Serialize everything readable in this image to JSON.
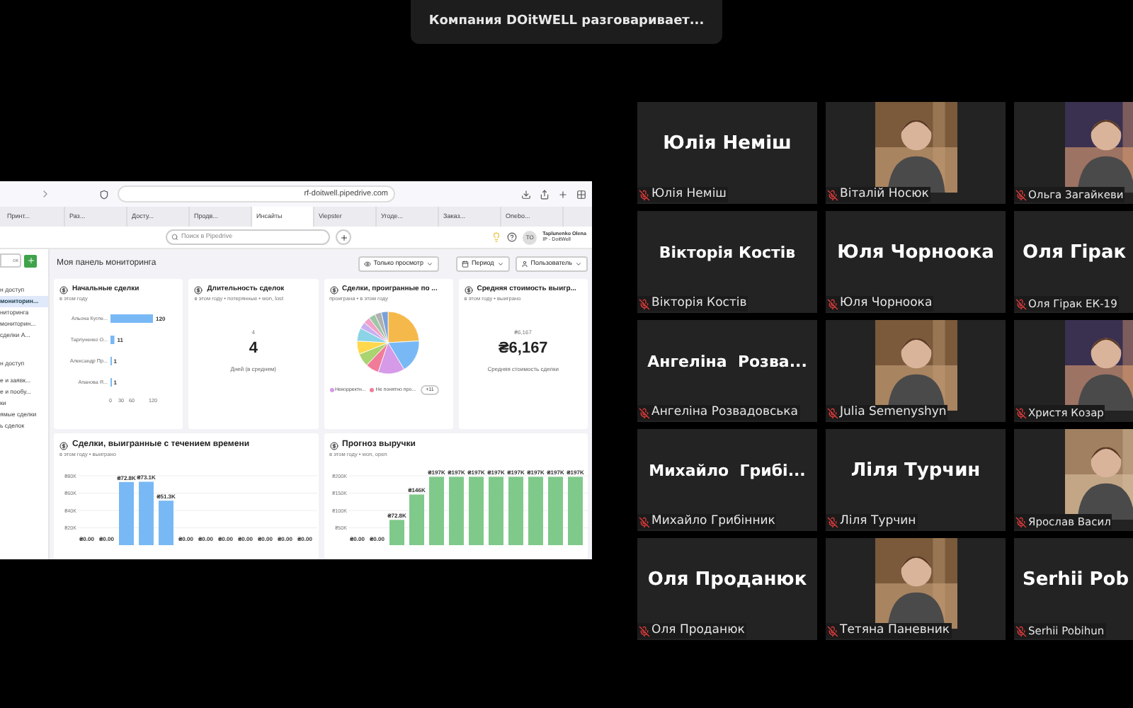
{
  "meeting_banner": {
    "title": "Компания DOitWELL разговаривает..."
  },
  "shared_screen": {
    "browser": {
      "url": "rf-doitwell.pipedrive.com",
      "tabs": [
        {
          "label": "Принт...",
          "selected": false
        },
        {
          "label": "Раз...",
          "selected": false
        },
        {
          "label": "Досту...",
          "selected": false
        },
        {
          "label": "Продв...",
          "selected": false
        },
        {
          "label": "Инсайты",
          "selected": true
        },
        {
          "label": "Viepster",
          "selected": false
        },
        {
          "label": "Угоде...",
          "selected": false
        },
        {
          "label": "Заказ...",
          "selected": false
        },
        {
          "label": "Onebo...",
          "selected": false
        }
      ]
    },
    "header": {
      "search_placeholder": "Поиск в Pipedrive",
      "avatar_initials": "TO",
      "user_name": "Taplunenko Olena",
      "user_company": "IP - DoitWell"
    },
    "sidebar": {
      "search_placeholder": "ок",
      "items": [
        {
          "label": "н доступ",
          "selected": false
        },
        {
          "label": "мониторин...",
          "selected": true
        },
        {
          "label": "ниторинга",
          "selected": false
        },
        {
          "label": "мониторин...",
          "selected": false
        },
        {
          "label": "сделки А...",
          "selected": false
        },
        {
          "label": "н доступ",
          "selected": false
        },
        {
          "label": "е и заявк...",
          "selected": false
        },
        {
          "label": "е и пообу...",
          "selected": false
        },
        {
          "label": "ки",
          "selected": false
        },
        {
          "label": "ямые сделки",
          "selected": false
        },
        {
          "label": "ь сделок",
          "selected": false
        }
      ]
    },
    "dashboard": {
      "title": "Моя панель мониторинга",
      "buttons": [
        "Только просмотр",
        "Период",
        "Пользователь"
      ],
      "cards": [
        {
          "kind": "hbar",
          "title": "Начальные сделки",
          "subtitle": "в этом году",
          "chart_data": {
            "type": "bar",
            "orientation": "horizontal",
            "categories": [
              "Альона Кугле...",
              "Тарлуненко О...",
              "Александр Пр...",
              "Апанова Я..."
            ],
            "values": [
              120,
              11,
              1,
              1
            ],
            "data_labels": true,
            "xlim": [
              0,
              120
            ],
            "xticks": [
              0,
              30,
              60,
              120
            ]
          }
        },
        {
          "kind": "number",
          "title": "Длительность сделок",
          "subtitle": "в этом году • потерянные • won, lost",
          "delta": "4",
          "value": "4",
          "caption": "Дней (в среднем)"
        },
        {
          "kind": "pie",
          "title": "Сделки, проигранные по ...",
          "subtitle": "проиграна • в этом году",
          "legend": [
            {
              "label": "Некорректн...",
              "color": "#d59ae8"
            },
            {
              "label": "Не понятно про...",
              "color": "#f07c9a"
            }
          ],
          "more": "+11"
        },
        {
          "kind": "number",
          "title": "Средняя стоимость выигр...",
          "subtitle": "в этом году • выиграно",
          "delta": "₴6,167",
          "value": "₴6,167",
          "caption": "Средняя стоимость сделки"
        },
        {
          "kind": "vbar",
          "title": "Сделки, выигранные с течением времени",
          "subtitle": "в этом году • выиграно",
          "chart_data": {
            "type": "bar",
            "categories": [
              null,
              null,
              null,
              null,
              null,
              null,
              null,
              null,
              null,
              null,
              null,
              null
            ],
            "grid": true,
            "ylim": [
              0,
              80
            ],
            "yticks": [
              {
                "value": 20,
                "label": "₴20K"
              },
              {
                "value": 40,
                "label": "₴40K"
              },
              {
                "value": 60,
                "label": "₴60K"
              },
              {
                "value": 80,
                "label": "₴80K"
              }
            ],
            "values": [
              0,
              0,
              72.8,
              73.1,
              51.3,
              0,
              0,
              0,
              0,
              0,
              0,
              0
            ],
            "value_labels": [
              "₴0.00",
              "₴0.00",
              "₴72.8K",
              "₴73.1K",
              "₴51.3K",
              "₴0.00",
              "₴0.00",
              "₴0.00",
              "₴0.00",
              "₴0.00",
              "₴0.00",
              "₴0.00"
            ],
            "color": "#78b9f5"
          }
        },
        {
          "kind": "vbar",
          "title": "Прогноз выручки",
          "subtitle": "в этом году • won, open",
          "chart_data": {
            "type": "bar",
            "categories": [
              null,
              null,
              null,
              null,
              null,
              null,
              null,
              null,
              null,
              null,
              null,
              null
            ],
            "grid": true,
            "ylim": [
              0,
              200
            ],
            "yticks": [
              {
                "value": 50,
                "label": "₴50K"
              },
              {
                "value": 100,
                "label": "₴100K"
              },
              {
                "value": 150,
                "label": "₴150K"
              },
              {
                "value": 200,
                "label": "₴200K"
              }
            ],
            "values": [
              0,
              0,
              72.8,
              146,
              197,
              197,
              197,
              197,
              197,
              197,
              197,
              197
            ],
            "value_labels": [
              "₴0.00",
              "₴0.00",
              "₴72.8K",
              "₴146K",
              "₴197K",
              "₴197K",
              "₴197K",
              "₴197K",
              "₴197K",
              "₴197K",
              "₴197K",
              "₴197K"
            ],
            "color": "#7fc98a"
          }
        }
      ]
    }
  },
  "participants": [
    {
      "kind": "name",
      "display": "Юлія Неміш",
      "label": "Юлія Неміш",
      "muted": true
    },
    {
      "label": "Віталій Носюк",
      "muted": true
    },
    {
      "label": "Ольга Загайкеви",
      "muted": true
    },
    {
      "kind": "name",
      "display": "Вікторія Костів",
      "label": "Вікторія Костів",
      "muted": true
    },
    {
      "kind": "name",
      "display": "Юля Чорноока",
      "label": "Юля Чорноока",
      "muted": true
    },
    {
      "kind": "name",
      "display": "Оля Гірак",
      "label": "Оля Гірак ЕК-19",
      "muted": true
    },
    {
      "kind": "name",
      "display": "Ангеліна  Розва...",
      "label": "Ангеліна Розвадовська",
      "muted": true
    },
    {
      "label": "Julia Semenyshyn",
      "muted": true
    },
    {
      "label": "Христя Козар",
      "muted": true
    },
    {
      "kind": "name",
      "display": "Михайло  Грибі...",
      "label": "Михайло Грибінник",
      "muted": true
    },
    {
      "kind": "name",
      "display": "Ліля Турчин",
      "label": "Ліля Турчин",
      "muted": true
    },
    {
      "label": "Ярослав Васил",
      "muted": true
    },
    {
      "kind": "name",
      "display": "Оля Проданюк",
      "label": "Оля Проданюк",
      "muted": true
    },
    {
      "label": "Тетяна Паневник",
      "muted": true
    },
    {
      "kind": "name",
      "display": "Serhii Pob",
      "label": "Serhii Pobihun",
      "muted": true
    }
  ]
}
